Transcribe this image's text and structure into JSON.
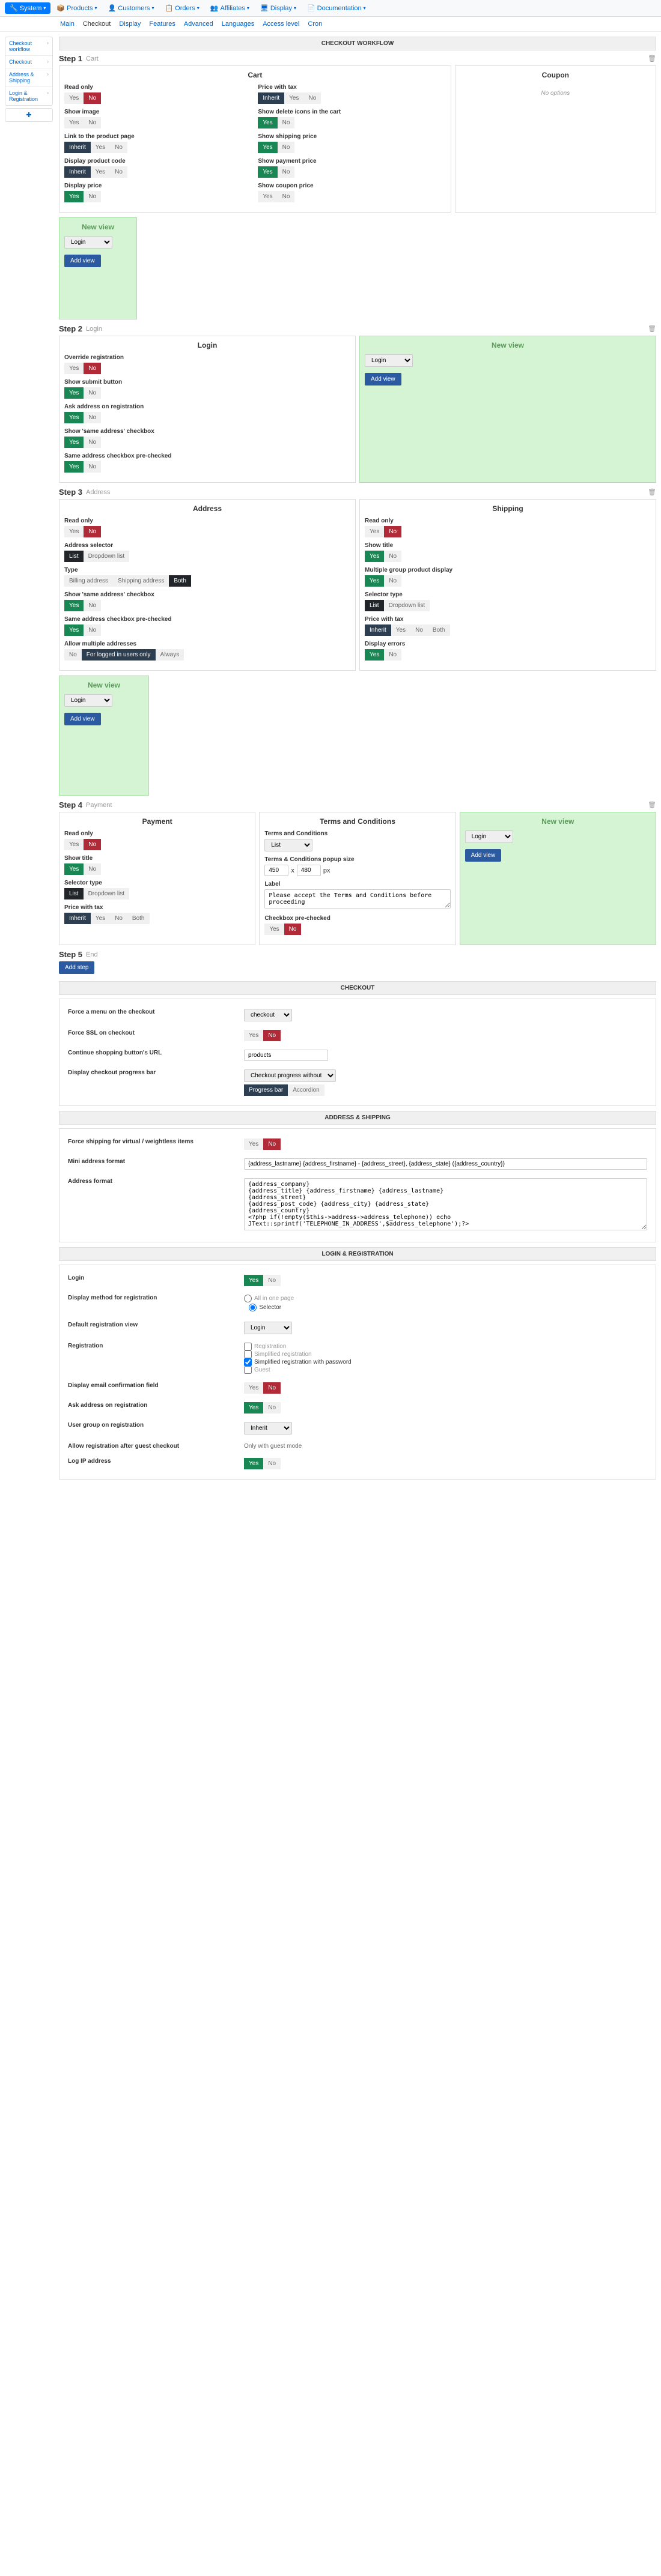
{
  "topnav": [
    {
      "icon": "🔧",
      "label": "System",
      "active": true
    },
    {
      "icon": "📦",
      "label": "Products"
    },
    {
      "icon": "👤",
      "label": "Customers"
    },
    {
      "icon": "📋",
      "label": "Orders"
    },
    {
      "icon": "👥",
      "label": "Affiliates"
    },
    {
      "icon": "🖥",
      "label": "Display"
    },
    {
      "icon": "📄",
      "label": "Documentation"
    }
  ],
  "subnav": [
    "Main",
    "Checkout",
    "Display",
    "Features",
    "Advanced",
    "Languages",
    "Access level",
    "Cron"
  ],
  "subnav_active": "Checkout",
  "sidebar": [
    "Checkout workflow",
    "Checkout",
    "Address & Shipping",
    "Login & Registration"
  ],
  "workflow_title": "CHECKOUT WORKFLOW",
  "labels": {
    "yes": "Yes",
    "no": "No",
    "inherit": "Inherit",
    "both": "Both",
    "list": "List",
    "dropdown": "Dropdown list",
    "add_view": "Add view",
    "new_view": "New view",
    "add_step": "Add step",
    "login_opt": "Login",
    "no_options": "No options",
    "always": "Always",
    "for_logged": "For logged in users only",
    "all_in_one": "All in one page",
    "selector": "Selector",
    "progress_bar": "Progress bar",
    "accordion": "Accordion"
  },
  "step1": {
    "title": "Step 1",
    "name": "Cart",
    "cart": {
      "title": "Cart",
      "read_only": "Read only",
      "price_with_tax": "Price with tax",
      "show_image": "Show image",
      "show_delete": "Show delete icons in the cart",
      "link_product": "Link to the product page",
      "show_shipping": "Show shipping price",
      "display_code": "Display product code",
      "show_payment": "Show payment price",
      "display_price": "Display price",
      "show_coupon": "Show coupon price"
    },
    "coupon": {
      "title": "Coupon"
    }
  },
  "step2": {
    "title": "Step 2",
    "name": "Login",
    "login": {
      "title": "Login",
      "override": "Override registration",
      "submit": "Show submit button",
      "ask_address": "Ask address on registration",
      "show_same": "Show 'same address' checkbox",
      "same_prechecked": "Same address checkbox pre-checked"
    }
  },
  "step3": {
    "title": "Step 3",
    "name": "Address",
    "address": {
      "title": "Address",
      "read_only": "Read only",
      "selector": "Address selector",
      "type": "Type",
      "billing": "Billing address",
      "shipping": "Shipping address",
      "show_same": "Show 'same address' checkbox",
      "same_prechecked": "Same address checkbox pre-checked",
      "allow_multi": "Allow multiple addresses"
    },
    "shipping": {
      "title": "Shipping",
      "read_only": "Read only",
      "show_title": "Show title",
      "multi_group": "Multiple group product display",
      "selector_type": "Selector type",
      "price_tax": "Price with tax",
      "display_errors": "Display errors"
    }
  },
  "step4": {
    "title": "Step 4",
    "name": "Payment",
    "payment": {
      "title": "Payment",
      "read_only": "Read only",
      "show_title": "Show title",
      "selector_type": "Selector type",
      "price_tax": "Price with tax"
    },
    "tc": {
      "title": "Terms and Conditions",
      "tc_label": "Terms and Conditions",
      "popup_size": "Terms & Conditions popup size",
      "w": "450",
      "h": "480",
      "px": "px",
      "label": "Label",
      "label_val": "Please accept the Terms and Conditions before proceeding",
      "prechecked": "Checkbox pre-checked"
    }
  },
  "step5": {
    "title": "Step 5",
    "name": "End"
  },
  "checkout_section": {
    "title": "CHECKOUT",
    "force_menu": "Force a menu on the checkout",
    "menu_val": "checkout",
    "force_ssl": "Force SSL on checkout",
    "continue_url": "Continue shopping button's URL",
    "url_val": "products",
    "progress": "Display checkout progress bar",
    "progress_val": "Checkout progress without"
  },
  "address_section": {
    "title": "ADDRESS & SHIPPING",
    "force_shipping": "Force shipping for virtual / weightless items",
    "mini_format": "Mini address format",
    "mini_val": "{address_lastname} {address_firstname} - {address_street}, {address_state} ({address_country})",
    "address_format": "Address format",
    "format_val": "{address_company}\n{address_title} {address_firstname} {address_lastname}\n{address_street}\n{address_post_code} {address_city} {address_state}\n{address_country}\n<?php if(!empty($this->address->address_telephone)) echo JText::sprintf('TELEPHONE_IN_ADDRESS',$address_telephone');?>"
  },
  "login_section": {
    "title": "LOGIN & REGISTRATION",
    "login": "Login",
    "method": "Display method for registration",
    "default_view": "Default registration view",
    "registration": "Registration",
    "reg_opts": [
      "Registration",
      "Simplified registration",
      "Simplified registration with password",
      "Guest"
    ],
    "email_confirm": "Display email confirmation field",
    "ask_address": "Ask address on registration",
    "user_group": "User group on registration",
    "group_val": "Inherit",
    "allow_guest": "Allow registration after guest checkout",
    "guest_note": "Only with guest mode",
    "log_ip": "Log IP address"
  }
}
